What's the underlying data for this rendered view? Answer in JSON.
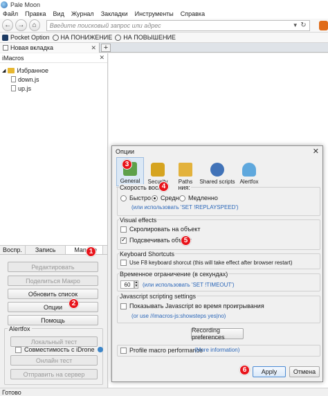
{
  "window": {
    "title": "Pale Moon"
  },
  "menu": [
    "Файл",
    "Правка",
    "Вид",
    "Журнал",
    "Закладки",
    "Инструменты",
    "Справка"
  ],
  "nav": {
    "address_placeholder": "Введите поисковый запрос или адрес"
  },
  "bookmarks": [
    "Pocket Option",
    "НА ПОНИЖЕНИЕ",
    "НА ПОВЫШЕНИЕ"
  ],
  "tabs": {
    "active": "Новая вкладка",
    "new_tab": "+"
  },
  "sidebar": {
    "title": "iMacros",
    "tree": {
      "folder": "Избранное",
      "files": [
        "down.js",
        "up.js"
      ]
    },
    "panel_tabs": [
      "Воспр.",
      "Запись",
      "Manage"
    ],
    "buttons": [
      "Редактировать",
      "Поделиться Макро",
      "Обновить список",
      "Опции",
      "Помощь"
    ],
    "alertfox": {
      "label": "Alertfox",
      "local_test": "Локальный тест",
      "compat_label": "Совместимость с iDrone",
      "online_test": "Онлайн тест",
      "send_server": "Отправить на сервер"
    }
  },
  "status": {
    "text": "Готово"
  },
  "dialog": {
    "title": "Опции",
    "toolbar": [
      "General",
      "Security",
      "Paths",
      "Shared scripts",
      "Alertfox"
    ],
    "speed": {
      "label": "Скорость воспро",
      "label_tail": "ния:",
      "options": [
        "Быстро",
        "Средне",
        "Медленно"
      ],
      "selected": "Средне",
      "hint": "(или использовать 'SET !REPLAYSPEED')"
    },
    "visual": {
      "label": "Visual effects",
      "scroll": "Скролировать на объект",
      "scroll_checked": false,
      "highlight": "Подсвечивать объект",
      "highlight_checked": true
    },
    "shortcuts": {
      "label": "Keyboard Shortcuts",
      "f8": "Use F8 keyboard shorcut (this will take effect after browser restart)",
      "f8_checked": false
    },
    "timeout": {
      "label": "Временное ограничение (в секундах)",
      "value": "60",
      "hint": "(или использовать 'SET !TIMEOUT')"
    },
    "js": {
      "label": "Javascript scripting settings",
      "show": "Показывать Javascript во время проигрывания",
      "show_checked": false,
      "hint": "(or use //imacros-js:showsteps yes|no)"
    },
    "recording_btn": "Recording preferences",
    "profile": {
      "label": "Profile macro performance",
      "checked": false,
      "more": "(More information)"
    },
    "apply": "Apply",
    "cancel": "Отмена"
  },
  "markers": [
    "1",
    "2",
    "3",
    "4",
    "5",
    "6"
  ]
}
